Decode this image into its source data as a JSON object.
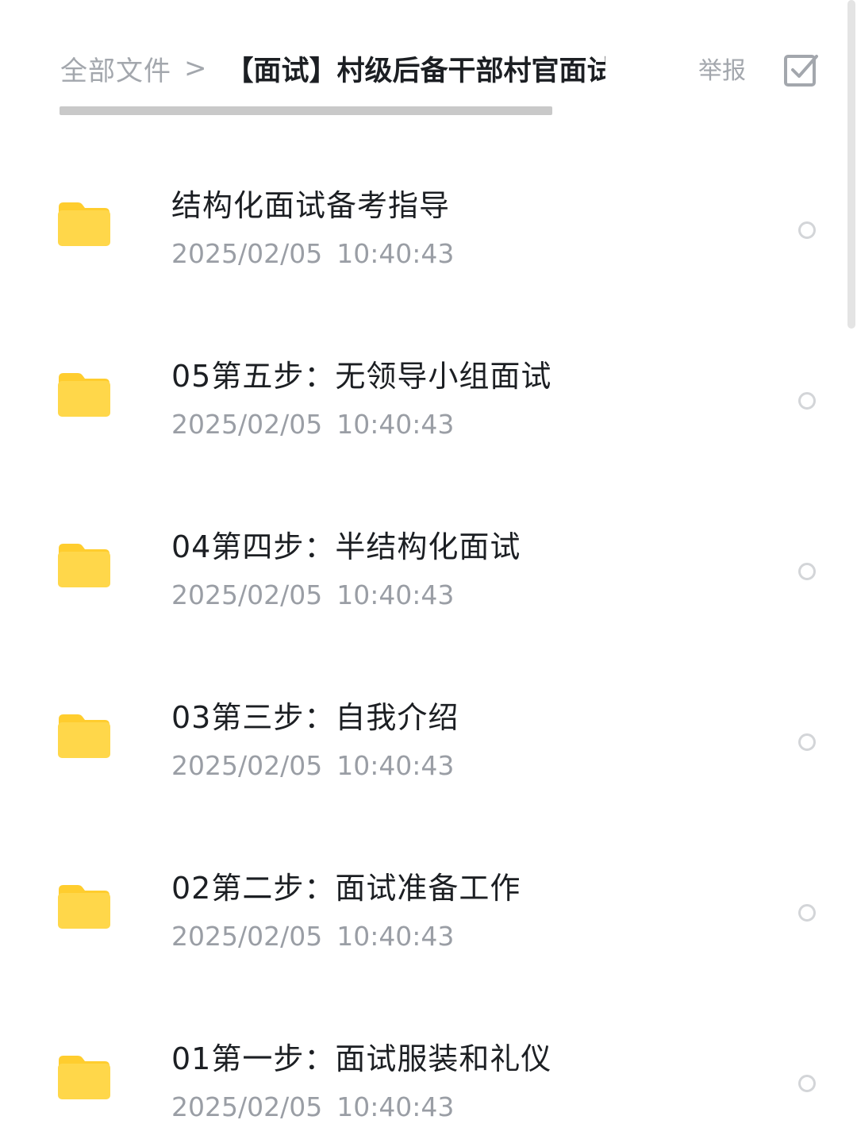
{
  "header": {
    "breadcrumb_root": "全部文件",
    "breadcrumb_separator": ">",
    "breadcrumb_current": "【面试】村级后备干部村官面试",
    "report_label": "举报",
    "select_icon": "checkbox-select-icon"
  },
  "files": [
    {
      "name": "结构化面试备考指导",
      "date": "2025/02/05",
      "time": "10:40:43",
      "icon": "folder-icon"
    },
    {
      "name": "05第五步：无领导小组面试",
      "date": "2025/02/05",
      "time": "10:40:43",
      "icon": "folder-icon"
    },
    {
      "name": "04第四步：半结构化面试",
      "date": "2025/02/05",
      "time": "10:40:43",
      "icon": "folder-icon"
    },
    {
      "name": "03第三步：自我介绍",
      "date": "2025/02/05",
      "time": "10:40:43",
      "icon": "folder-icon"
    },
    {
      "name": "02第二步：面试准备工作",
      "date": "2025/02/05",
      "time": "10:40:43",
      "icon": "folder-icon"
    },
    {
      "name": "01第一步：面试服装和礼仪",
      "date": "2025/02/05",
      "time": "10:40:43",
      "icon": "folder-icon"
    }
  ],
  "colors": {
    "folder": "#ffd74a",
    "folder_tab": "#ffcd2e",
    "title_text": "#1c1f23",
    "secondary_text": "#9a9ea5"
  }
}
